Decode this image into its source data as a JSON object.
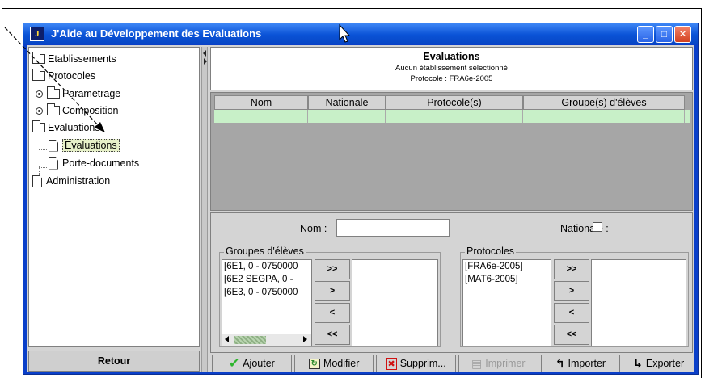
{
  "window": {
    "title": "J'Aide au Développement des Evaluations",
    "app_icon_glyph": "J",
    "controls": {
      "minimize": "_",
      "maximize": "□",
      "close": "✕"
    }
  },
  "tree": {
    "items": [
      {
        "label": "Etablissements",
        "icon": "folder-icon"
      },
      {
        "label": "Protocoles",
        "icon": "folder-open-icon"
      },
      {
        "label": "Parametrage",
        "icon": "folder-icon",
        "expander": true
      },
      {
        "label": "Composition",
        "icon": "folder-icon",
        "expander": true
      },
      {
        "label": "Evaluations",
        "icon": "folder-open-icon"
      },
      {
        "label": "Evaluations",
        "icon": "document-icon",
        "selected": true
      },
      {
        "label": "Porte-documents",
        "icon": "document-icon"
      },
      {
        "label": "Administration",
        "icon": "document-icon"
      }
    ],
    "retour_label": "Retour"
  },
  "header": {
    "title": "Evaluations",
    "line1": "Aucun établissement sélectionné",
    "line2": "Protocole : FRA6e-2005"
  },
  "table": {
    "columns": [
      "Nom",
      "Nationale",
      "Protocole(s)",
      "Groupe(s) d'élèves"
    ],
    "row_color": "#c8f0c8"
  },
  "form": {
    "nom_label": "Nom :",
    "nom_value": "",
    "nationale_label": "Nationale :",
    "nationale_checked": false,
    "groupes": {
      "title": "Groupes d'élèves",
      "items": [
        "[6E1, 0 - 0750000",
        "[6E2 SEGPA, 0 -",
        "[6E3, 0 - 0750000"
      ],
      "buttons": [
        ">>",
        ">",
        "<",
        "<<"
      ]
    },
    "protocoles": {
      "title": "Protocoles",
      "items": [
        "[FRA6e-2005]",
        "[MAT6-2005]"
      ],
      "buttons": [
        ">>",
        ">",
        "<",
        "<<"
      ]
    }
  },
  "toolbar": {
    "ajouter": "Ajouter",
    "modifier": "Modifier",
    "supprimer": "Supprim...",
    "imprimer": "Imprimer",
    "importer": "Importer",
    "exporter": "Exporter"
  },
  "colors": {
    "titlebar": "#0a52d6",
    "client_bg": "#d4d4d4",
    "selected_tree": "#e6f0c8",
    "table_bg": "#a6a6a6",
    "check_green": "#2db52d"
  }
}
